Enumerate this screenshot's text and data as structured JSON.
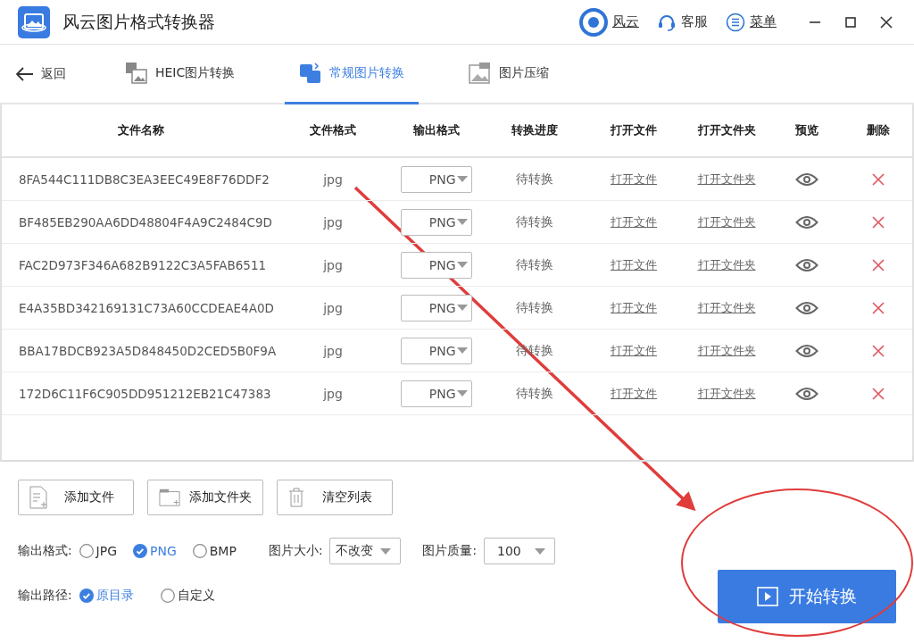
{
  "window": {
    "title": "风云图片格式转换器",
    "header_links": [
      {
        "kind": "account",
        "label": "风云"
      },
      {
        "kind": "support",
        "label": "客服"
      },
      {
        "kind": "menu",
        "label": "菜单"
      }
    ]
  },
  "nav": {
    "back": "返回",
    "tabs": [
      {
        "kind": "heic",
        "label": "HEIC图片转换",
        "selected": false
      },
      {
        "kind": "convert",
        "label": "常规图片转换",
        "selected": true
      },
      {
        "kind": "zip",
        "label": "图片压缩",
        "selected": false
      }
    ]
  },
  "table": {
    "columns": [
      "文件名称",
      "文件格式",
      "输出格式",
      "转换进度",
      "打开文件",
      "打开文件夹",
      "预览",
      "删除"
    ],
    "rows": [
      {
        "name": "8FA544C111DB8C3EA3EEC49E8F76DDF2",
        "format": "jpg",
        "output": "PNG",
        "progress": "待转换",
        "open_file": "打开文件",
        "open_folder": "打开文件夹"
      },
      {
        "name": "BF485EB290AA6DD48804F4A9C2484C9D",
        "format": "jpg",
        "output": "PNG",
        "progress": "待转换",
        "open_file": "打开文件",
        "open_folder": "打开文件夹"
      },
      {
        "name": "FAC2D973F346A682B9122C3A5FAB6511",
        "format": "jpg",
        "output": "PNG",
        "progress": "待转换",
        "open_file": "打开文件",
        "open_folder": "打开文件夹"
      },
      {
        "name": "E4A35BD342169131C73A60CCDEAE4A0D",
        "format": "jpg",
        "output": "PNG",
        "progress": "待转换",
        "open_file": "打开文件",
        "open_folder": "打开文件夹"
      },
      {
        "name": "BBA17BDCB923A5D848450D2CED5B0F9A",
        "format": "jpg",
        "output": "PNG",
        "progress": "待转换",
        "open_file": "打开文件",
        "open_folder": "打开文件夹"
      },
      {
        "name": "172D6C11F6C905DD951212EB21C47383",
        "format": "jpg",
        "output": "PNG",
        "progress": "待转换",
        "open_file": "打开文件",
        "open_folder": "打开文件夹"
      }
    ]
  },
  "actions": [
    {
      "kind": "file",
      "label": "添加文件"
    },
    {
      "kind": "folder",
      "label": "添加文件夹"
    },
    {
      "kind": "trash",
      "label": "清空列表"
    }
  ],
  "output_format": {
    "label": "输出格式:",
    "options": [
      {
        "label": "JPG",
        "selected": false
      },
      {
        "label": "PNG",
        "selected": true
      },
      {
        "label": "BMP",
        "selected": false
      }
    ]
  },
  "image_size": {
    "label": "图片大小:",
    "value": "不改变"
  },
  "image_quality": {
    "label": "图片质量:",
    "value": "100"
  },
  "output_path": {
    "label": "输出路径:",
    "options": [
      {
        "label": "原目录",
        "selected": true
      },
      {
        "label": "自定义",
        "selected": false
      }
    ]
  },
  "start_button": "开始转换"
}
